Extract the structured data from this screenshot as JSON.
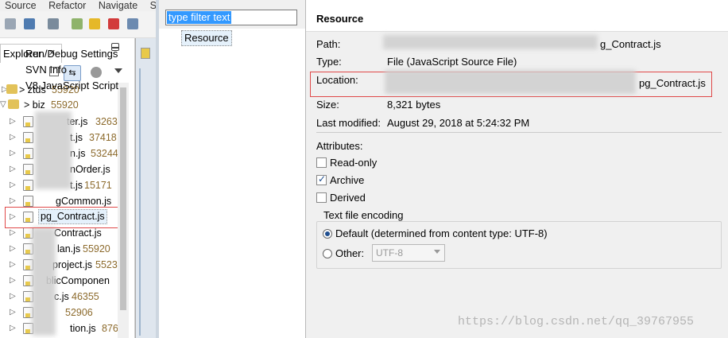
{
  "menubar": {
    "items": [
      "Source",
      "Refactor",
      "Navigate",
      "S"
    ]
  },
  "explorer": {
    "tab_label": "Explorer",
    "tab_close": "✕",
    "tree": [
      {
        "label": "> ztds",
        "size": "55920",
        "depth": 0
      },
      {
        "label": "> biz",
        "size": "55920",
        "depth": 1
      },
      {
        "label": "ter.js",
        "size": "3263",
        "depth": 2
      },
      {
        "label": "t.js",
        "size": "37418",
        "depth": 2
      },
      {
        "label": "n.js",
        "size": "53244",
        "depth": 2
      },
      {
        "label": "nOrder.js",
        "size": "",
        "depth": 2
      },
      {
        "label": "t.js",
        "size": "15171",
        "depth": 2
      },
      {
        "label": "gCommon.js",
        "size": "",
        "depth": 2
      },
      {
        "label": "pg_Contract.js",
        "size": "",
        "depth": 2
      },
      {
        "label": "Contract.js",
        "size": "",
        "depth": 2
      },
      {
        "label": "lan.js",
        "size": "55920",
        "depth": 2
      },
      {
        "label": "project.js",
        "size": "5523",
        "depth": 2
      },
      {
        "label": "blicComponen",
        "size": "",
        "depth": 2
      },
      {
        "label": "c.js",
        "size": "46355",
        "depth": 2
      },
      {
        "label": "",
        "size": "52906",
        "depth": 2
      },
      {
        "label": "tion.js",
        "size": "876",
        "depth": 2
      }
    ]
  },
  "dialog": {
    "filter_placeholder": "type filter text",
    "nav_items": [
      "Resource",
      "Run/Debug Settings",
      "SVN Info",
      "V8 JavaScript Script"
    ],
    "title": "Resource",
    "path_label": "Path:",
    "path_value": "g_Contract.js",
    "type_label": "Type:",
    "type_value": "File  (JavaScript Source File)",
    "location_label": "Location:",
    "location_value": "pg_Contract.js",
    "size_label": "Size:",
    "size_value": "8,321  bytes",
    "modified_label": "Last modified:",
    "modified_value": "August 29, 2018 at 5:24:32 PM",
    "attributes_label": "Attributes:",
    "readonly_label": "Read-only",
    "readonly_checked": false,
    "archive_label": "Archive",
    "archive_checked": true,
    "derived_label": "Derived",
    "derived_checked": false,
    "encoding_legend": "Text file encoding",
    "default_label": "Default (determined from content type: UTF-8)",
    "other_label": "Other:",
    "other_value": "UTF-8"
  },
  "watermark": "https://blog.csdn.net/qq_39767955"
}
